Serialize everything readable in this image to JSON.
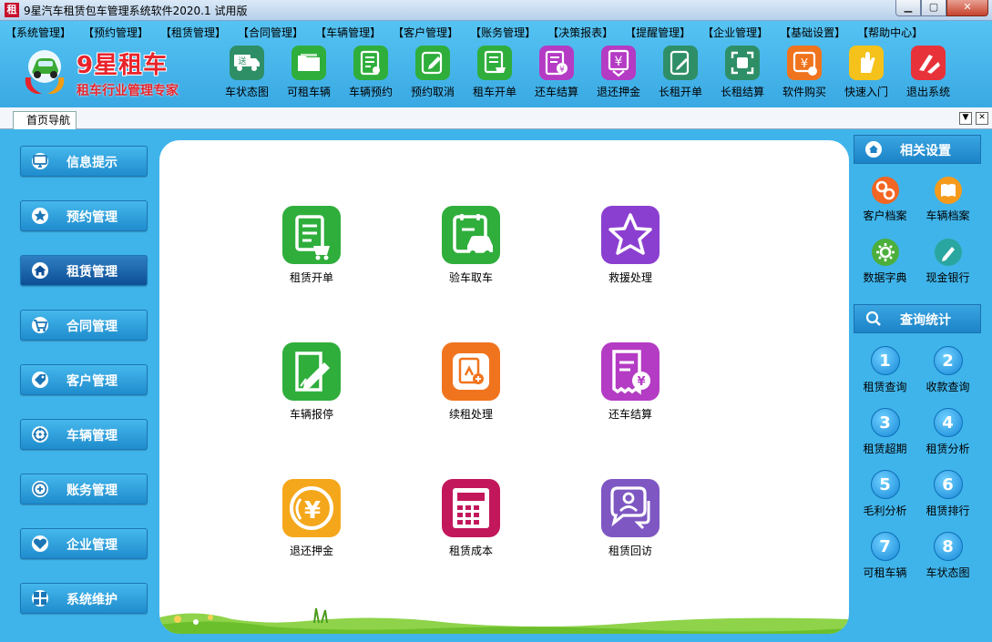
{
  "window": {
    "title": "9星汽车租赁包车管理系统软件2020.1 试用版",
    "app_icon": "租"
  },
  "menu": [
    "【系统管理】",
    "【预约管理】",
    "【租赁管理】",
    "【合同管理】",
    "【车辆管理】",
    "【客户管理】",
    "【账务管理】",
    "【决策报表】",
    "【提醒管理】",
    "【企业管理】",
    "【基础设置】",
    "【帮助中心】"
  ],
  "logo": {
    "title": "9星租车",
    "subtitle": "租车行业管理专家"
  },
  "toolbar": [
    {
      "label": "车状态图",
      "icon": "truck-icon",
      "color": "#2e8f67"
    },
    {
      "label": "可租车辆",
      "icon": "folder-icon",
      "color": "#2fae3c"
    },
    {
      "label": "车辆预约",
      "icon": "register-icon",
      "color": "#2fae3c"
    },
    {
      "label": "预约取消",
      "icon": "edit-icon",
      "color": "#2fae3c"
    },
    {
      "label": "租车开单",
      "icon": "cart-doc-icon",
      "color": "#2fae3c"
    },
    {
      "label": "还车结算",
      "icon": "yen-doc-icon",
      "color": "#b43bc4"
    },
    {
      "label": "退还押金",
      "icon": "yen-down-icon",
      "color": "#b43bc4"
    },
    {
      "label": "长租开单",
      "icon": "long-rent-icon",
      "color": "#2e8f67"
    },
    {
      "label": "长租结算",
      "icon": "settle-icon",
      "color": "#2e8f67"
    },
    {
      "label": "软件购买",
      "icon": "buy-icon",
      "color": "#f0741e"
    },
    {
      "label": "快速入门",
      "icon": "hand-icon",
      "color": "#f5c21b"
    },
    {
      "label": "退出系统",
      "icon": "exit-icon",
      "color": "#e8323a"
    }
  ],
  "tab": {
    "label": "首页导航"
  },
  "leftnav": [
    {
      "label": "信息提示",
      "icon": "monitor-icon",
      "active": false
    },
    {
      "label": "预约管理",
      "icon": "star-icon",
      "active": false
    },
    {
      "label": "租赁管理",
      "icon": "home-icon",
      "active": true
    },
    {
      "label": "合同管理",
      "icon": "cart-icon",
      "active": false
    },
    {
      "label": "客户管理",
      "icon": "tag-icon",
      "active": false
    },
    {
      "label": "车辆管理",
      "icon": "target-icon",
      "active": false
    },
    {
      "label": "账务管理",
      "icon": "plus-circle-icon",
      "active": false
    },
    {
      "label": "企业管理",
      "icon": "heart-icon",
      "active": false
    },
    {
      "label": "系统维护",
      "icon": "grid-icon",
      "active": false
    }
  ],
  "grid": [
    {
      "label": "租赁开单",
      "icon": "rent-order-icon",
      "color": "#2fae3c"
    },
    {
      "label": "验车取车",
      "icon": "car-check-icon",
      "color": "#2fae3c"
    },
    {
      "label": "救援处理",
      "icon": "star-outline-icon",
      "color": "#8b3fd0"
    },
    {
      "label": "车辆报停",
      "icon": "pen-doc-icon",
      "color": "#2fae3c"
    },
    {
      "label": "续租处理",
      "icon": "renew-icon",
      "color": "#f0741e"
    },
    {
      "label": "还车结算",
      "icon": "yen-receipt-icon",
      "color": "#b43bc4"
    },
    {
      "label": "退还押金",
      "icon": "yen-coin-icon",
      "color": "#f5a71b"
    },
    {
      "label": "租赁成本",
      "icon": "calculator-icon",
      "color": "#c2185b"
    },
    {
      "label": "租赁回访",
      "icon": "chat-icon",
      "color": "#7e57c2"
    }
  ],
  "right": {
    "settings": {
      "title": "相关设置",
      "items": [
        {
          "label": "客户档案",
          "icon": "link-icon",
          "color": "#f26522"
        },
        {
          "label": "车辆档案",
          "icon": "book-icon",
          "color": "#f59a1b"
        },
        {
          "label": "数据字典",
          "icon": "gear-icon",
          "color": "#4caf3c"
        },
        {
          "label": "现金银行",
          "icon": "pencil-icon",
          "color": "#2aa6a0"
        }
      ]
    },
    "query": {
      "title": "查询统计",
      "items": [
        {
          "num": "1",
          "label": "租赁查询"
        },
        {
          "num": "2",
          "label": "收款查询"
        },
        {
          "num": "3",
          "label": "租赁超期"
        },
        {
          "num": "4",
          "label": "租赁分析"
        },
        {
          "num": "5",
          "label": "毛利分析"
        },
        {
          "num": "6",
          "label": "租赁排行"
        },
        {
          "num": "7",
          "label": "可租车辆"
        },
        {
          "num": "8",
          "label": "车状态图"
        }
      ]
    }
  }
}
